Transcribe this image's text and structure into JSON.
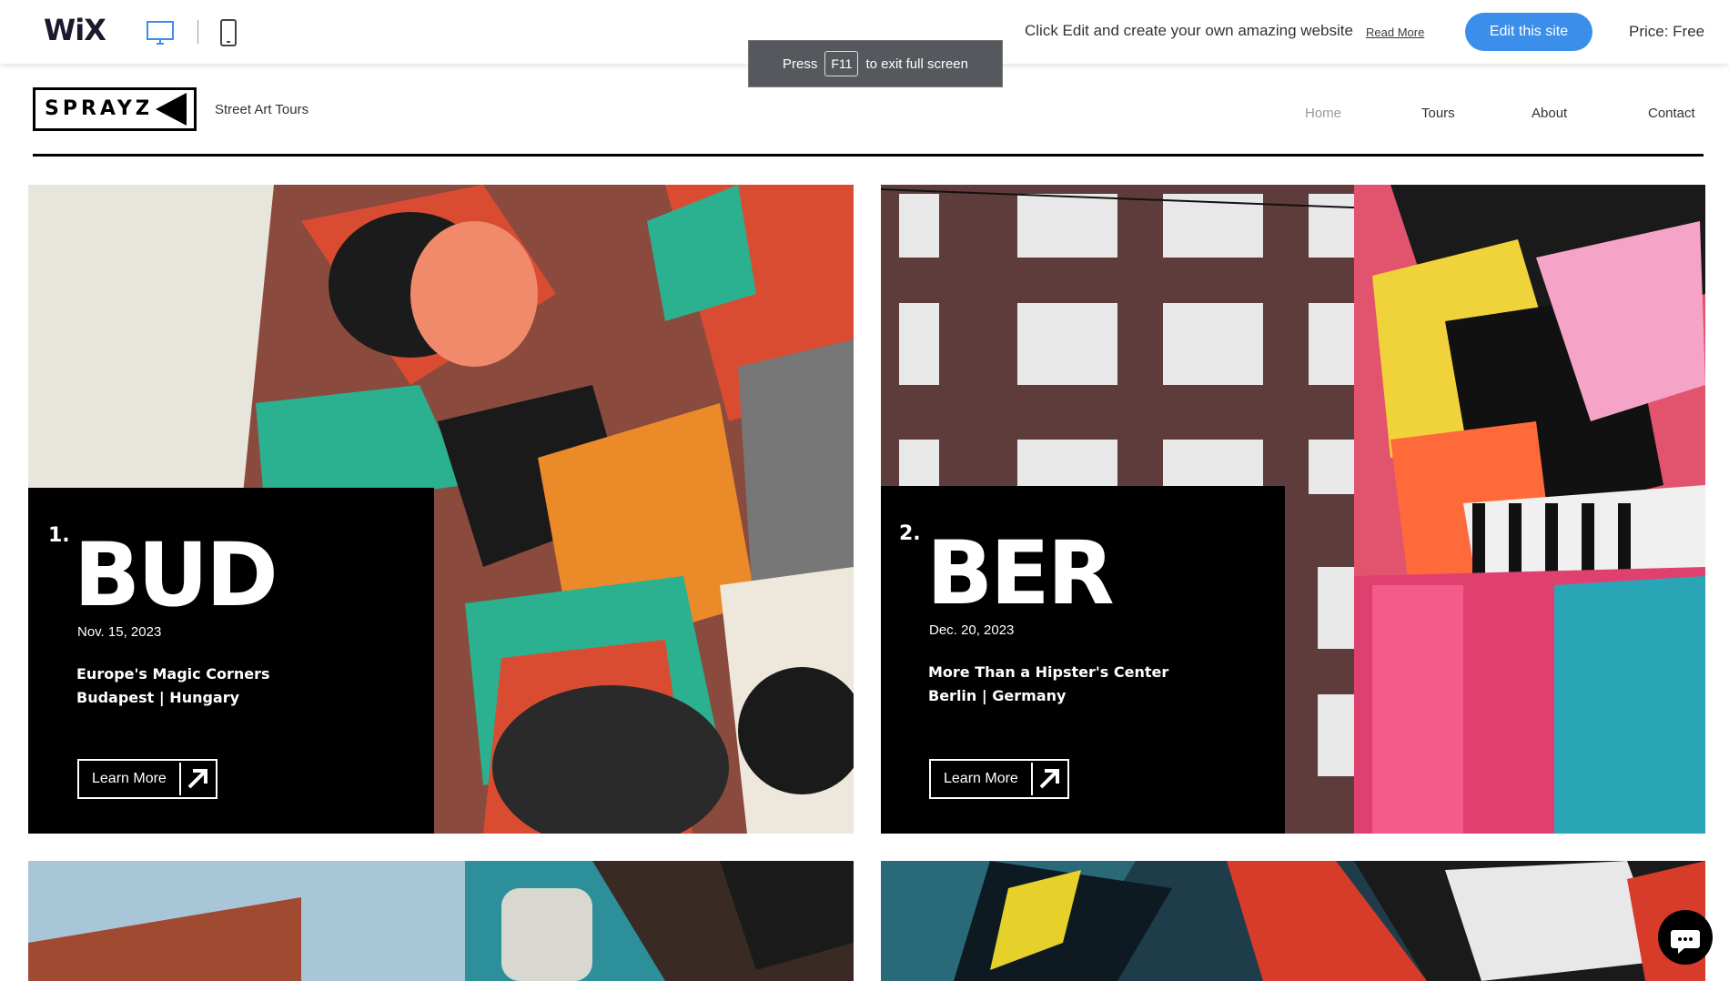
{
  "wix_bar": {
    "logo": "WiX",
    "promo_text": "Click Edit and create your own amazing website",
    "read_more": "Read More",
    "edit_button": "Edit this site",
    "price": "Price: Free",
    "accent_color": "#3b8eea"
  },
  "toast": {
    "press": "Press",
    "key": "F11",
    "rest": "to exit full screen"
  },
  "site": {
    "logo": "SPRAYZ",
    "tagline": "Street Art Tours",
    "nav": [
      "Home",
      "Tours",
      "About",
      "Contact"
    ],
    "active_nav": "Home"
  },
  "tours": [
    {
      "number": "1.",
      "city": "BUD",
      "date": "Nov. 15, 2023",
      "line1": "Europe's Magic Corners",
      "line2": "Budapest | Hungary",
      "cta": "Learn More"
    },
    {
      "number": "2.",
      "city": "BER",
      "date": "Dec. 20, 2023",
      "line1": "More Than a Hipster's Center",
      "line2": "Berlin | Germany",
      "cta": "Learn More"
    }
  ]
}
